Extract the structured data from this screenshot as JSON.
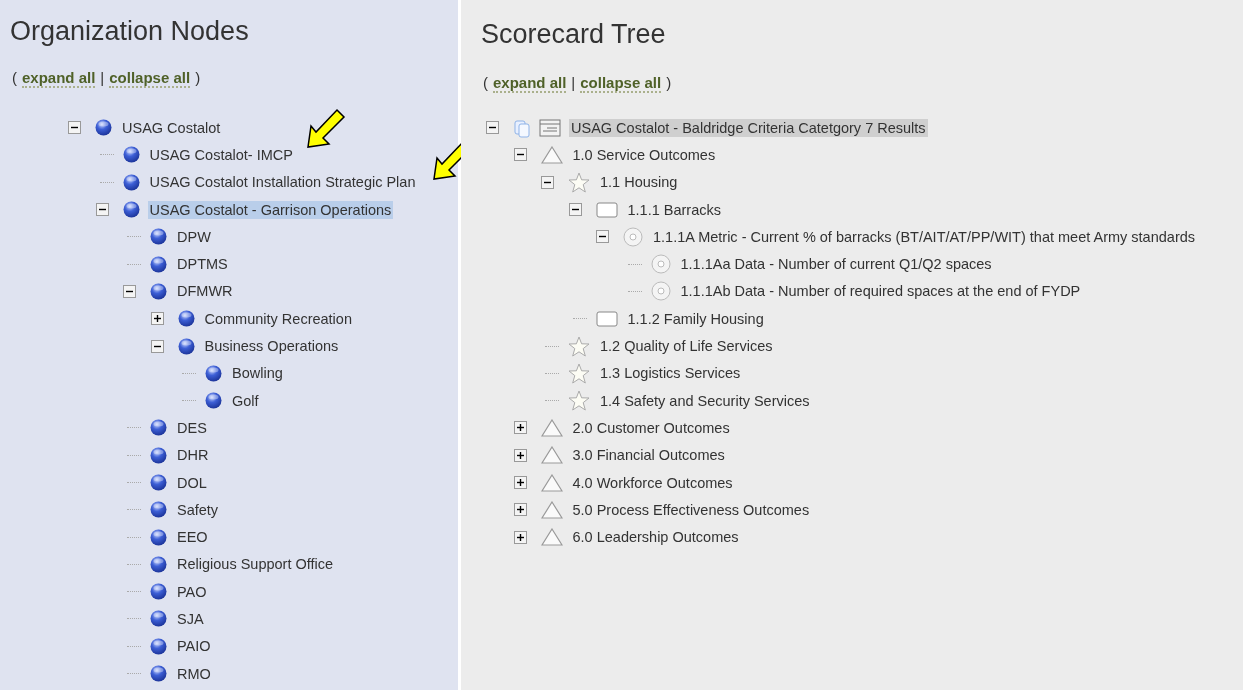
{
  "panels": [
    {
      "title": "Organization Nodes",
      "links": {
        "open": "(",
        "expand": "expand all",
        "separator": "|",
        "collapse": "collapse all",
        "close": ")"
      },
      "nodes": [
        {
          "label": "USAG Costalot",
          "kind": "org",
          "expanded": true,
          "selected": false,
          "children": [
            {
              "label": "USAG Costalot- IMCP",
              "kind": "org",
              "selected": false
            },
            {
              "label": "USAG Costalot Installation Strategic Plan",
              "kind": "org",
              "selected": false
            },
            {
              "label": "USAG Costalot - Garrison Operations",
              "kind": "org",
              "expanded": true,
              "selected": true,
              "children": [
                {
                  "label": "DPW",
                  "kind": "org",
                  "selected": false
                },
                {
                  "label": "DPTMS",
                  "kind": "org",
                  "selected": false
                },
                {
                  "label": "DFMWR",
                  "kind": "org",
                  "expanded": true,
                  "selected": false,
                  "children": [
                    {
                      "label": "Community Recreation",
                      "kind": "org",
                      "expanded": false,
                      "selected": false
                    },
                    {
                      "label": "Business Operations",
                      "kind": "org",
                      "expanded": true,
                      "selected": false,
                      "children": [
                        {
                          "label": "Bowling",
                          "kind": "org",
                          "selected": false
                        },
                        {
                          "label": "Golf",
                          "kind": "org",
                          "selected": false
                        }
                      ]
                    }
                  ]
                },
                {
                  "label": "DES",
                  "kind": "org",
                  "selected": false
                },
                {
                  "label": "DHR",
                  "kind": "org",
                  "selected": false
                },
                {
                  "label": "DOL",
                  "kind": "org",
                  "selected": false
                },
                {
                  "label": "Safety",
                  "kind": "org",
                  "selected": false
                },
                {
                  "label": "EEO",
                  "kind": "org",
                  "selected": false
                },
                {
                  "label": "Religious Support Office",
                  "kind": "org",
                  "selected": false
                },
                {
                  "label": "PAO",
                  "kind": "org",
                  "selected": false
                },
                {
                  "label": "SJA",
                  "kind": "org",
                  "selected": false
                },
                {
                  "label": "PAIO",
                  "kind": "org",
                  "selected": false
                },
                {
                  "label": "RMO",
                  "kind": "org",
                  "selected": false
                }
              ]
            }
          ]
        }
      ]
    },
    {
      "title": "Scorecard Tree",
      "links": {
        "open": "(",
        "expand": "expand all",
        "separator": "|",
        "collapse": "collapse all",
        "close": ")"
      },
      "nodes": [
        {
          "label": "USAG Costalot - Baldridge Criteria Catetgory 7 Results",
          "kind": "scorecard",
          "expanded": true,
          "selected": true,
          "children": [
            {
              "label": "1.0 Service Outcomes",
              "kind": "perspective",
              "expanded": true,
              "selected": false,
              "children": [
                {
                  "label": "1.1 Housing",
                  "kind": "objective",
                  "expanded": true,
                  "selected": false,
                  "children": [
                    {
                      "label": "1.1.1 Barracks",
                      "kind": "category",
                      "expanded": true,
                      "selected": false,
                      "children": [
                        {
                          "label": "1.1.1A Metric - Current % of barracks (BT/AIT/AT/PP/WIT) that meet Army standards",
                          "kind": "metric",
                          "expanded": true,
                          "selected": false,
                          "children": [
                            {
                              "label": "1.1.1Aa Data - Number of current Q1/Q2 spaces",
                              "kind": "metric",
                              "selected": false
                            },
                            {
                              "label": "1.1.1Ab Data - Number of required spaces at the end of FYDP",
                              "kind": "metric",
                              "selected": false
                            }
                          ]
                        }
                      ]
                    },
                    {
                      "label": "1.1.2 Family Housing",
                      "kind": "category",
                      "selected": false
                    }
                  ]
                },
                {
                  "label": "1.2 Quality of Life Services",
                  "kind": "objective",
                  "selected": false
                },
                {
                  "label": "1.3 Logistics Services",
                  "kind": "objective",
                  "selected": false
                },
                {
                  "label": "1.4 Safety and Security Services",
                  "kind": "objective",
                  "selected": false
                }
              ]
            },
            {
              "label": "2.0 Customer Outcomes",
              "kind": "perspective",
              "expanded": false,
              "selected": false
            },
            {
              "label": "3.0 Financial Outcomes",
              "kind": "perspective",
              "expanded": false,
              "selected": false
            },
            {
              "label": "4.0 Workforce Outcomes",
              "kind": "perspective",
              "expanded": false,
              "selected": false
            },
            {
              "label": "5.0 Process Effectiveness Outcomes",
              "kind": "perspective",
              "expanded": false,
              "selected": false
            },
            {
              "label": "6.0 Leadership Outcomes",
              "kind": "perspective",
              "expanded": false,
              "selected": false
            }
          ]
        }
      ]
    }
  ]
}
